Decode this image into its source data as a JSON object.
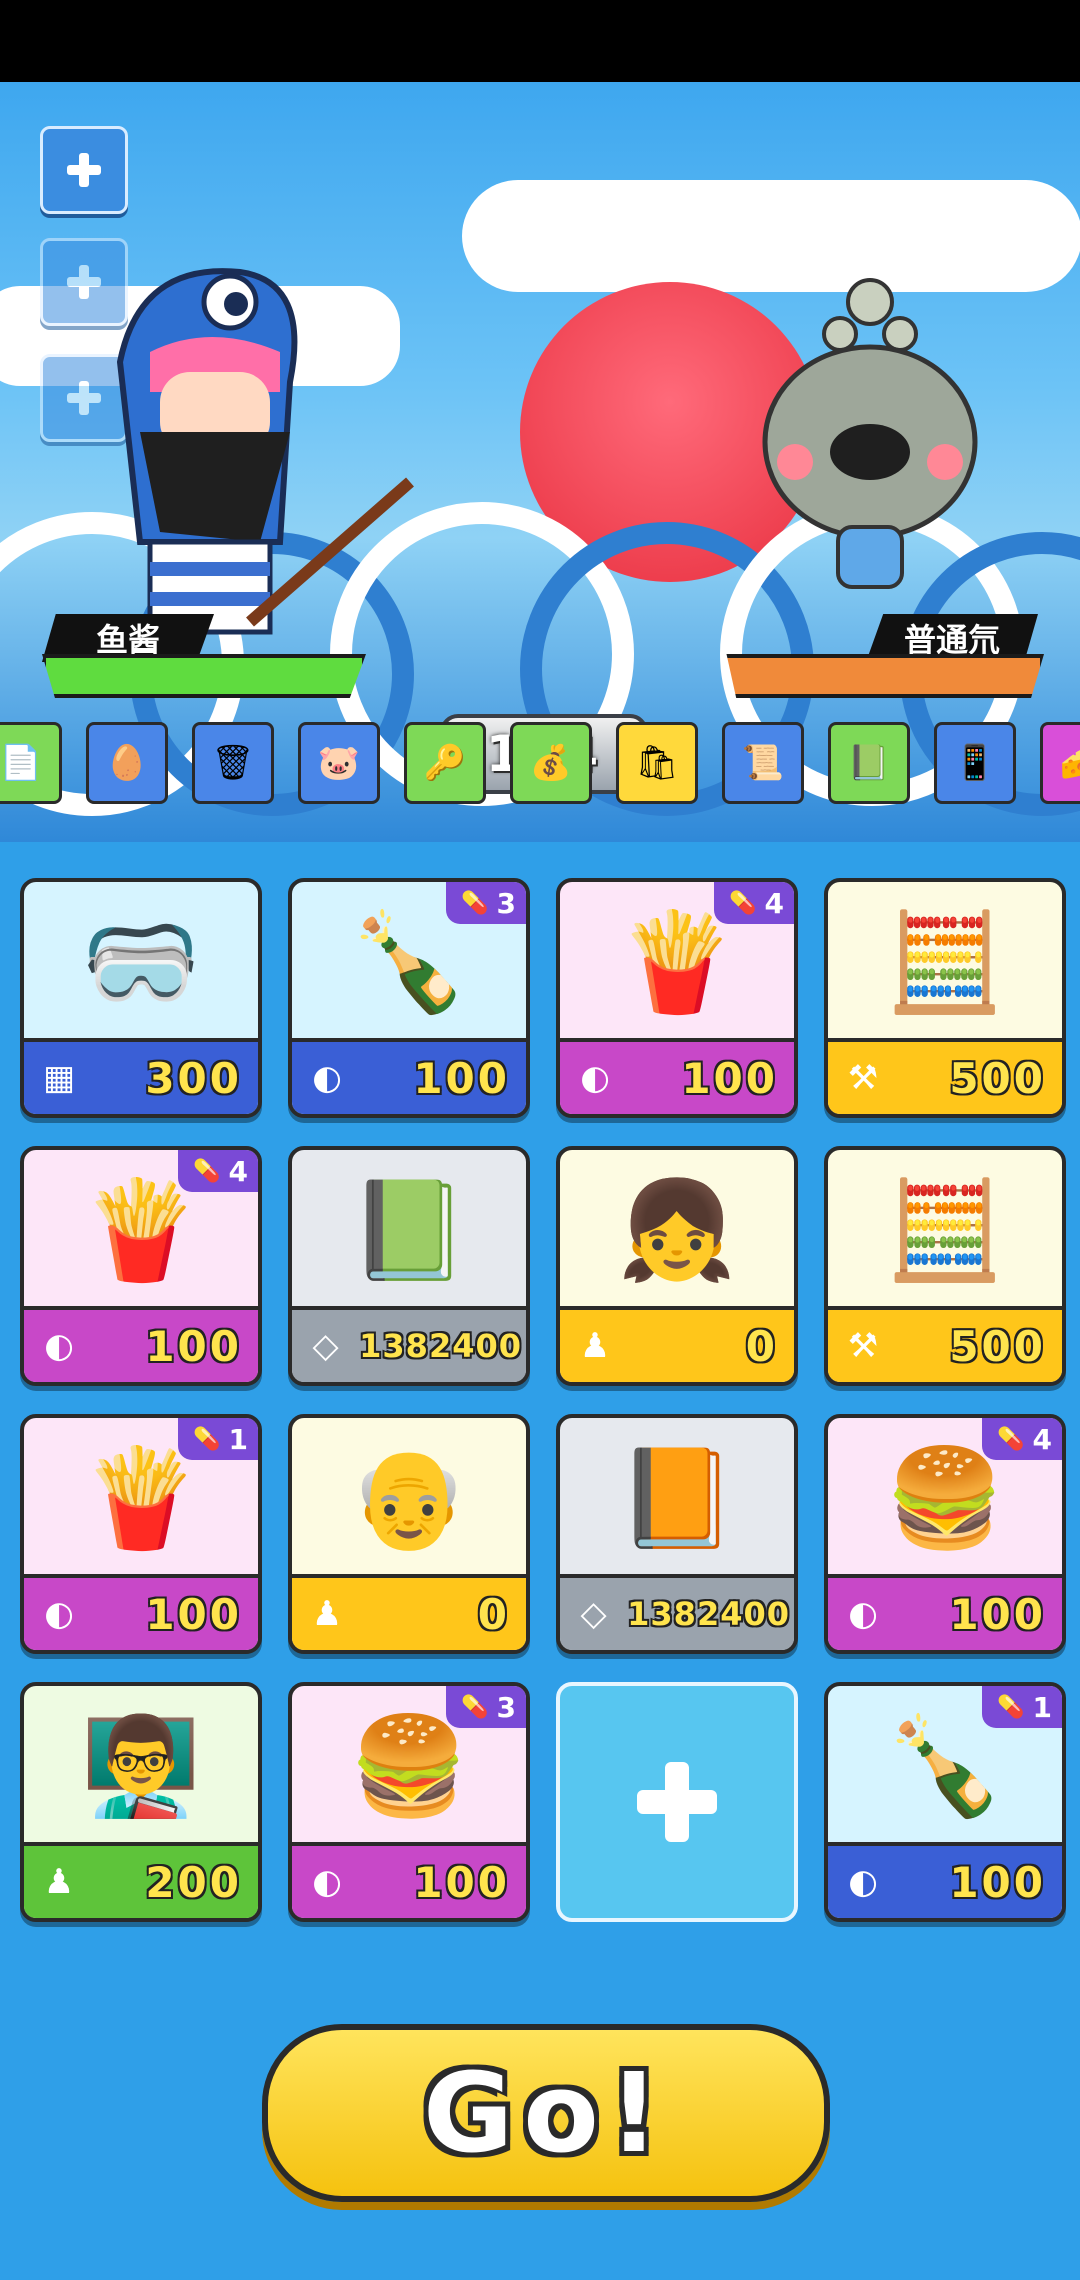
{
  "battle": {
    "player": {
      "name": "鱼酱",
      "hp_fraction": 1.0,
      "hp_color": "#5fdc3f"
    },
    "enemy": {
      "name": "普通氘",
      "hp_fraction": 1.0,
      "hp_color": "#f08a3a"
    },
    "turn_counter": "124"
  },
  "shop_items": [
    {
      "icon": "document-icon",
      "glyph": "📄",
      "color": "#7ed957"
    },
    {
      "icon": "nest-eggs-icon",
      "glyph": "🥚",
      "color": "#4a86e8"
    },
    {
      "icon": "trash-bin-icon",
      "glyph": "🗑",
      "color": "#4a86e8"
    },
    {
      "icon": "piggy-bank-icon",
      "glyph": "🐷",
      "color": "#4a86e8"
    },
    {
      "icon": "key-icon",
      "glyph": "🔑",
      "color": "#7ed957"
    },
    {
      "icon": "coins-icon",
      "glyph": "💰",
      "color": "#7ed957"
    },
    {
      "icon": "shopping-bag-icon",
      "glyph": "🛍",
      "color": "#ffd93b"
    },
    {
      "icon": "map-scroll-icon",
      "glyph": "📜",
      "color": "#4a86e8"
    },
    {
      "icon": "calendar-icon",
      "glyph": "📗",
      "color": "#7ed957"
    },
    {
      "icon": "phone-icon",
      "glyph": "📱",
      "color": "#4a86e8"
    },
    {
      "icon": "cheese-icon",
      "glyph": "🧀",
      "color": "#d94fd9"
    }
  ],
  "cards": [
    {
      "name": "vr-headset",
      "glyph": "🥽",
      "bg": "#d6f4ff",
      "bar": "#3a5fd6",
      "cost_icon": "chip-icon",
      "cost_glyph": "▦",
      "price": "300",
      "badge": null
    },
    {
      "name": "cola-bottle",
      "glyph": "🍾",
      "bg": "#d6f4ff",
      "bar": "#3a5fd6",
      "cost_icon": "bread-icon",
      "cost_glyph": "◐",
      "price": "100",
      "badge": "3"
    },
    {
      "name": "french-fries",
      "glyph": "🍟",
      "bg": "#fde6f8",
      "bar": "#c848c8",
      "cost_icon": "bread-icon",
      "cost_glyph": "◐",
      "price": "100",
      "badge": "4"
    },
    {
      "name": "abacus",
      "glyph": "🧮",
      "bg": "#fdfbe2",
      "bar": "#ffc61a",
      "cost_icon": "hammer-icon",
      "cost_glyph": "⚒",
      "price": "500",
      "badge": null
    },
    {
      "name": "french-fries",
      "glyph": "🍟",
      "bg": "#fde6f8",
      "bar": "#c848c8",
      "cost_icon": "bread-icon",
      "cost_glyph": "◐",
      "price": "100",
      "badge": "4"
    },
    {
      "name": "chemistry-book",
      "glyph": "📗",
      "bg": "#e6e9ee",
      "bar": "#9aa3ad",
      "cost_icon": "eraser-icon",
      "cost_glyph": "◇",
      "price": "1382400",
      "badge": null
    },
    {
      "name": "glasses-girl",
      "glyph": "👧",
      "bg": "#fdfbe2",
      "bar": "#ffc61a",
      "cost_icon": "student-icon",
      "cost_glyph": "♟",
      "price": "0",
      "badge": null
    },
    {
      "name": "abacus",
      "glyph": "🧮",
      "bg": "#fdfbe2",
      "bar": "#ffc61a",
      "cost_icon": "hammer-icon",
      "cost_glyph": "⚒",
      "price": "500",
      "badge": null
    },
    {
      "name": "french-fries",
      "glyph": "🍟",
      "bg": "#fde6f8",
      "bar": "#c848c8",
      "cost_icon": "bread-icon",
      "cost_glyph": "◐",
      "price": "100",
      "badge": "1"
    },
    {
      "name": "einstein-professor",
      "glyph": "👴",
      "bg": "#fdfbe2",
      "bar": "#ffc61a",
      "cost_icon": "student-icon",
      "cost_glyph": "♟",
      "price": "0",
      "badge": null
    },
    {
      "name": "math-book",
      "glyph": "📙",
      "bg": "#e6e9ee",
      "bar": "#9aa3ad",
      "cost_icon": "eraser-icon",
      "cost_glyph": "◇",
      "price": "1382400",
      "badge": null
    },
    {
      "name": "hamburger",
      "glyph": "🍔",
      "bg": "#fde6f8",
      "bar": "#c848c8",
      "cost_icon": "bread-icon",
      "cost_glyph": "◐",
      "price": "100",
      "badge": "4"
    },
    {
      "name": "teacher",
      "glyph": "👨‍🏫",
      "bg": "#eefbe2",
      "bar": "#5ec43a",
      "cost_icon": "student-icon",
      "cost_glyph": "♟",
      "price": "200",
      "badge": null
    },
    {
      "name": "hamburger",
      "glyph": "🍔",
      "bg": "#fde6f8",
      "bar": "#c848c8",
      "cost_icon": "bread-icon",
      "cost_glyph": "◐",
      "price": "100",
      "badge": "3"
    },
    {
      "name": "empty-slot",
      "empty": true
    },
    {
      "name": "cola-bottle",
      "glyph": "🍾",
      "bg": "#d6f4ff",
      "bar": "#3a5fd6",
      "cost_icon": "bread-icon",
      "cost_glyph": "◐",
      "price": "100",
      "badge": "1"
    }
  ],
  "go_button": {
    "label": "Go!"
  }
}
